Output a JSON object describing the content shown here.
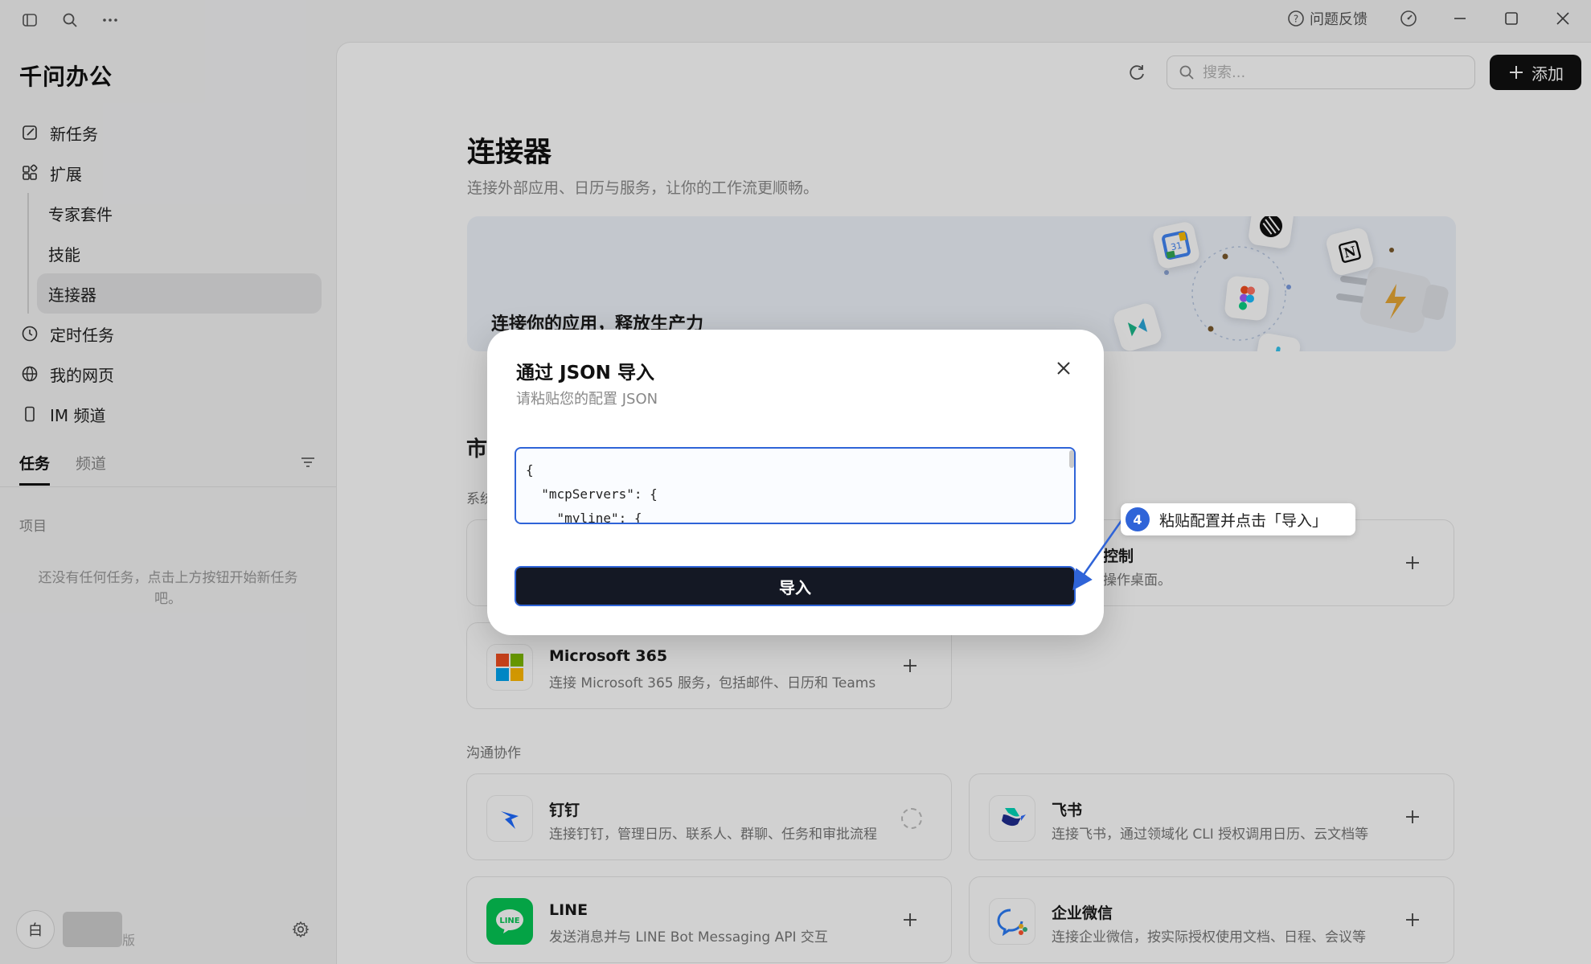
{
  "app": {
    "title": "千问办公",
    "feedback_label": "问题反馈"
  },
  "sidebar": {
    "nav": [
      {
        "label": "新任务",
        "icon": "edit-icon"
      },
      {
        "label": "扩展",
        "icon": "extensions-icon"
      }
    ],
    "subnav": [
      {
        "label": "专家套件"
      },
      {
        "label": "技能"
      },
      {
        "label": "连接器",
        "active": true
      }
    ],
    "nav2": [
      {
        "label": "定时任务",
        "icon": "clock-icon"
      },
      {
        "label": "我的网页",
        "icon": "globe-icon"
      },
      {
        "label": "IM 频道",
        "icon": "phone-icon"
      }
    ],
    "tabs": [
      {
        "label": "任务",
        "active": true
      },
      {
        "label": "频道",
        "active": false
      }
    ],
    "section_label": "项目",
    "empty_text": "还没有任何任务，点击上方按钮开始新任务吧。",
    "theme_label": "白",
    "version_suffix": "版"
  },
  "main": {
    "search_placeholder": "搜索...",
    "add_label": "添加",
    "title": "连接器",
    "subtitle": "连接外部应用、日历与服务，让你的工作流更顺畅。",
    "banner_text": "连接你的应用，释放生产力",
    "market_title_fragment": "市",
    "group_system_fragment": "系统",
    "group_comm": "沟通协作",
    "cards": {
      "control": {
        "name": "控制",
        "desc": "操作桌面。"
      },
      "ms365": {
        "name": "Microsoft 365",
        "desc": "连接 Microsoft 365 服务，包括邮件、日历和 Teams"
      },
      "dingtalk": {
        "name": "钉钉",
        "desc": "连接钉钉，管理日历、联系人、群聊、任务和审批流程"
      },
      "feishu": {
        "name": "飞书",
        "desc": "连接飞书，通过领域化 CLI 授权调用日历、云文档等"
      },
      "line": {
        "name": "LINE",
        "desc": "发送消息并与 LINE Bot Messaging API 交互"
      },
      "wecom": {
        "name": "企业微信",
        "desc": "连接企业微信，按实际授权使用文档、日程、会议等"
      }
    }
  },
  "modal": {
    "title": "通过 JSON 导入",
    "subtitle": "请粘贴您的配置 JSON",
    "json_text": "{\n  \"mcpServers\": {\n    \"myline\": {",
    "import_label": "导入"
  },
  "callout": {
    "step": "4",
    "text": "粘贴配置并点击「导入」"
  },
  "colors": {
    "accent": "#2f64d8",
    "primary_button": "#111111",
    "overlay": "rgba(0,0,0,0.18)"
  }
}
